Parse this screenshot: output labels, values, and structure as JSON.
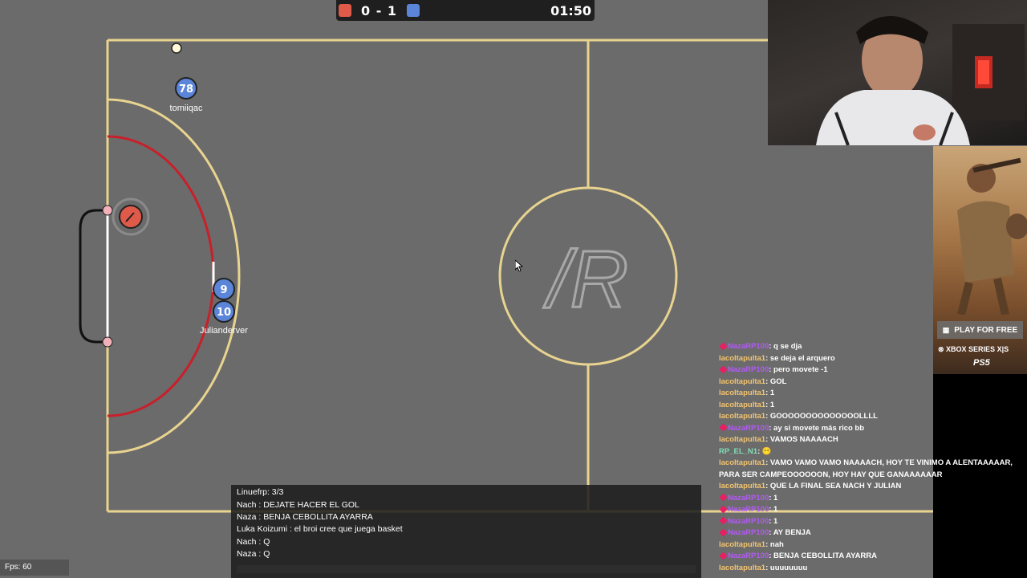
{
  "scoreboard": {
    "red_color": "#e05a4a",
    "blue_color": "#5b85d9",
    "score": "0 - 1",
    "timer": "01:50"
  },
  "players": [
    {
      "number": "78",
      "name": "tomiiqac",
      "team": "blue"
    },
    {
      "number": "9",
      "name": "",
      "team": "blue"
    },
    {
      "number": "10",
      "name": "Julianderver",
      "team": "blue"
    },
    {
      "number": "",
      "name": "",
      "team": "red",
      "icon": "pencil-icon"
    }
  ],
  "center_logo": "/R",
  "twitch_chat": [
    {
      "user": "NazaRP100",
      "color": "purple",
      "badge": true,
      "text": "q se dja"
    },
    {
      "user": "lacoltapulta1",
      "color": "orange",
      "badge": false,
      "text": "se deja el arquero"
    },
    {
      "user": "NazaRP100",
      "color": "purple",
      "badge": true,
      "text": "pero movete -1"
    },
    {
      "user": "lacoltapulta1",
      "color": "orange",
      "badge": false,
      "text": "GOL"
    },
    {
      "user": "lacoltapulta1",
      "color": "orange",
      "badge": false,
      "text": "1"
    },
    {
      "user": "lacoltapulta1",
      "color": "orange",
      "badge": false,
      "text": "1"
    },
    {
      "user": "lacoltapulta1",
      "color": "orange",
      "badge": false,
      "text": "GOOOOOOOOOOOOOOLLLL"
    },
    {
      "user": "NazaRP100",
      "color": "purple",
      "badge": true,
      "text": "ay si movete más rico bb"
    },
    {
      "user": "lacoltapulta1",
      "color": "orange",
      "badge": false,
      "text": "VAMOS NAAAACH"
    },
    {
      "user": "RP_EL_N1",
      "color": "green",
      "badge": false,
      "text": "😶"
    },
    {
      "user": "lacoltapulta1",
      "color": "orange",
      "badge": false,
      "text": "VAMO VAMO VAMO NAAAACH, HOY TE VINIMO A ALENTAAAAAR, PARA SER CAMPEOOOOOON, HOY HAY QUE GANAAAAAAR"
    },
    {
      "user": "lacoltapulta1",
      "color": "orange",
      "badge": false,
      "text": "QUE LA FINAL SEA NACH Y JULIAN"
    },
    {
      "user": "NazaRP100",
      "color": "purple",
      "badge": true,
      "text": "1"
    },
    {
      "user": "NazaRP100",
      "color": "purple",
      "badge": true,
      "text": "1"
    },
    {
      "user": "NazaRP100",
      "color": "purple",
      "badge": true,
      "text": "1"
    },
    {
      "user": "NazaRP100",
      "color": "purple",
      "badge": true,
      "text": "AY BENJA"
    },
    {
      "user": "lacoltapulta1",
      "color": "orange",
      "badge": false,
      "text": "nah"
    },
    {
      "user": "NazaRP100",
      "color": "purple",
      "badge": true,
      "text": "BENJA CEBOLLITA AYARRA"
    },
    {
      "user": "lacoltapulta1",
      "color": "orange",
      "badge": false,
      "text": "uuuuuuuu"
    }
  ],
  "game_chat": [
    "Linuefrp: 3/3",
    "Nach : DEJATE HACER EL GOL",
    "Naza : BENJA CEBOLLITA AYARRA",
    "Luka Koizumi : el broi cree que juega basket",
    "Nach : Q",
    "Naza : Q"
  ],
  "ad": {
    "button": "PLAY FOR FREE",
    "platform1": "XBOX SERIES X|S",
    "platform2": "PS5"
  },
  "fps": "Fps: 60"
}
